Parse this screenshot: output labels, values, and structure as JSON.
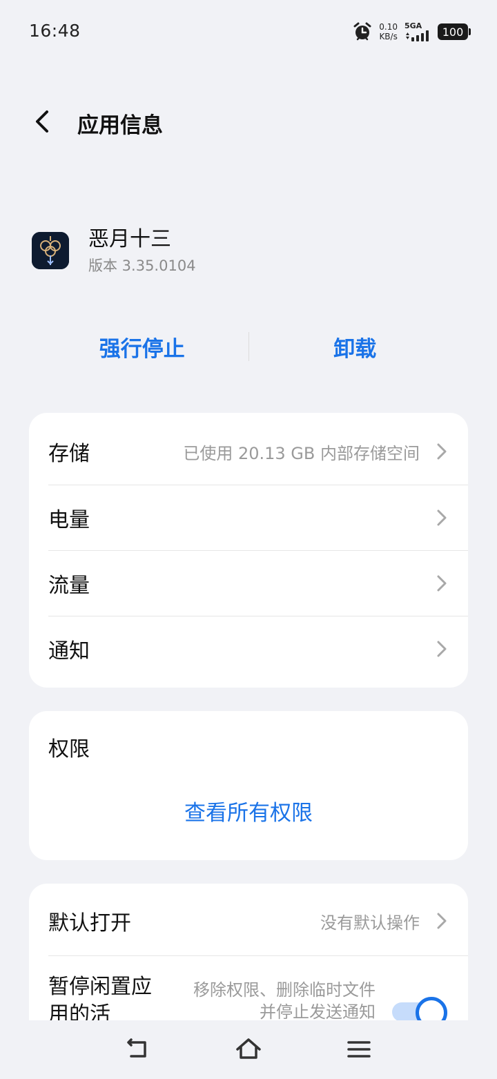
{
  "status_bar": {
    "time": "16:48",
    "net_speed_value": "0.10",
    "net_speed_unit": "KB/s",
    "network_type": "5GA",
    "battery": "100",
    "icons": [
      "alarm-icon",
      "signal-icon",
      "battery-icon"
    ]
  },
  "header": {
    "title": "应用信息",
    "back_icon": "chevron-left-icon"
  },
  "app": {
    "name": "恶月十三",
    "version": "版本 3.35.0104"
  },
  "actions": {
    "force_stop": "强行停止",
    "uninstall": "卸载"
  },
  "settings": [
    {
      "label": "存储",
      "value": "已使用 20.13 GB 内部存储空间"
    },
    {
      "label": "电量",
      "value": ""
    },
    {
      "label": "流量",
      "value": ""
    },
    {
      "label": "通知",
      "value": ""
    }
  ],
  "permissions": {
    "title": "权限",
    "link": "查看所有权限"
  },
  "defaults": {
    "label": "默认打开",
    "value": "没有默认操作"
  },
  "pause_unused": {
    "label": "暂停闲置应用的活",
    "description": "移除权限、删除临时文件并停止发送通知",
    "enabled": true
  },
  "colors": {
    "accent": "#1a73e8",
    "background": "#f1f2f6",
    "card": "#ffffff"
  }
}
